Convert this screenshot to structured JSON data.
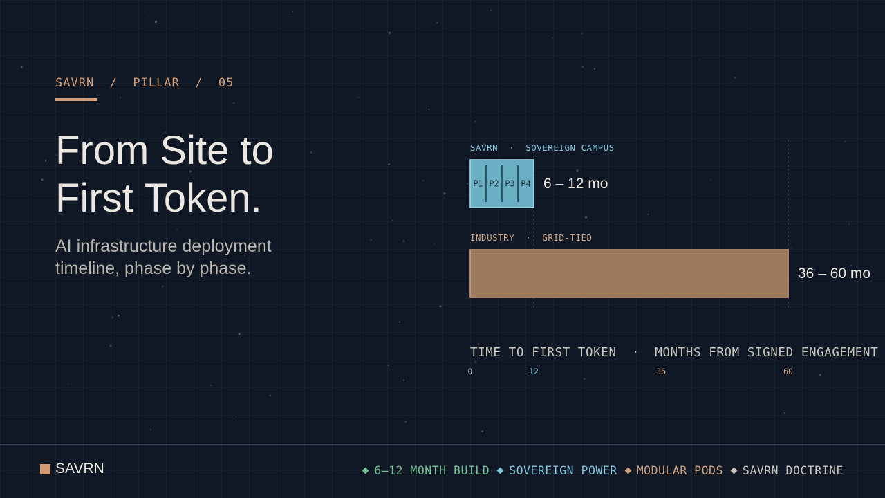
{
  "header": {
    "breadcrumb": "SAVRN  /  PILLAR  /  05",
    "title_line1": "From Site to",
    "title_line2": "First Token.",
    "subtitle_line1": "AI infrastructure deployment",
    "subtitle_line2": "timeline, phase by phase."
  },
  "chart_data": {
    "type": "bar",
    "orientation": "horizontal",
    "xlabel": "TIME TO FIRST TOKEN  ·  MONTHS FROM SIGNED ENGAGEMENT",
    "xlim": [
      0,
      60
    ],
    "xticks": [
      0,
      12,
      36,
      60
    ],
    "series": [
      {
        "name": "SAVRN  ·  SOVEREIGN CAMPUS",
        "range": [
          0,
          12
        ],
        "value_label": "6 – 12 mo",
        "segments": [
          "P1",
          "P2",
          "P3",
          "P4"
        ],
        "color": "#6aafc4"
      },
      {
        "name": "INDUSTRY  ·  GRID-TIED",
        "range": [
          0,
          60
        ],
        "value_label": "36 – 60 mo",
        "color": "#9c7a5e"
      }
    ]
  },
  "footer": {
    "brand": "SAVRN",
    "tags": [
      {
        "label": "6–12 MONTH BUILD",
        "color": "#6fbf92"
      },
      {
        "label": "SOVEREIGN POWER",
        "color": "#82c6dc"
      },
      {
        "label": "MODULAR PODS",
        "color": "#cfa080"
      },
      {
        "label": "SAVRN DOCTRINE",
        "color": "#c9c5be"
      }
    ]
  },
  "colors": {
    "accent": "#d29b74",
    "background": "#0f1824",
    "savrn_bar": "#6aafc4",
    "industry_bar": "#9c7a5e"
  }
}
